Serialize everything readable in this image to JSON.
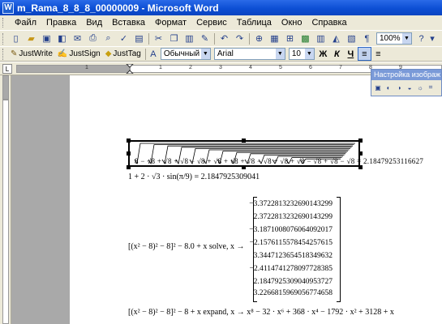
{
  "window": {
    "title": "m_Rama_8_8_8_00000009 - Microsoft Word",
    "app_icon": "word-icon"
  },
  "menu": [
    "Файл",
    "Правка",
    "Вид",
    "Вставка",
    "Формат",
    "Сервис",
    "Таблица",
    "Окно",
    "Справка"
  ],
  "toolbar_standard": {
    "zoom": "100%",
    "help": "?"
  },
  "toolbar_formatting": {
    "justwrite": "JustWrite",
    "justsign": "JustSign",
    "justtag": "JustTag",
    "style": "Обычный + ни",
    "font": "Arial",
    "size": "10",
    "bold": "Ж",
    "italic": "К",
    "underline": "Ч"
  },
  "picture_toolbar": {
    "title": "Настройка изображ"
  },
  "ruler": {
    "marks": [
      "1",
      "1",
      "2",
      "3",
      "4",
      "5",
      "6",
      "7",
      "8",
      "9"
    ]
  },
  "document": {
    "nested_radical": {
      "text": "8 − √8 + √8 + √8 − √8 + √8 + √8 + √8 − √8 + √8 + √8 − √8 + √8 − √8 = 2.18479253116627",
      "value": "2.18479253116627"
    },
    "equation2": "1 + 2 · √3 · sin(π/9) = 2.1847925309041",
    "equation3": "[(x² − 8)² − 8]² − 8.0 + x solve, x →",
    "solutions": [
      "−3.3722813232690143299",
      "2.3722813232690143299",
      "−3.1871008076064092017",
      "−2.1576115578454257615",
      "3.3447123654518349632",
      "−2.4114741278097728385",
      "2.1847925309040953727",
      "3.2266815969056774658"
    ],
    "equation4": "[(x² − 8)² − 8]² − 8 + x expand, x → x⁸ − 32 · x⁶ + 368 · x⁴ − 1792 · x² + 3128 + x"
  }
}
